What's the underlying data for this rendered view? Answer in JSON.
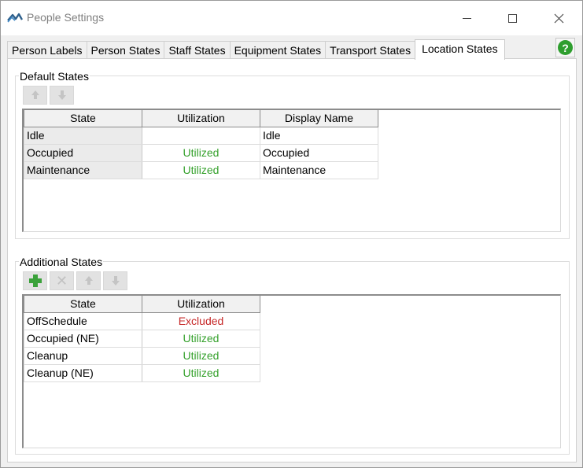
{
  "window": {
    "title": "People Settings"
  },
  "tabs": [
    {
      "label": "Person Labels"
    },
    {
      "label": "Person States"
    },
    {
      "label": "Staff States"
    },
    {
      "label": "Equipment States"
    },
    {
      "label": "Transport States"
    },
    {
      "label": "Location States",
      "active": true
    }
  ],
  "help_button": {
    "glyph": "?",
    "icon": "help-icon",
    "color": "#2e9e2e"
  },
  "default_states": {
    "group_label": "Default States",
    "columns": [
      "State",
      "Utilization",
      "Display Name"
    ],
    "rows": [
      {
        "state": "Idle",
        "utilization": "",
        "display_name": "Idle"
      },
      {
        "state": "Occupied",
        "utilization": "Utilized",
        "display_name": "Occupied"
      },
      {
        "state": "Maintenance",
        "utilization": "Utilized",
        "display_name": "Maintenance"
      }
    ],
    "toolbar": [
      "move-up-icon",
      "move-down-icon"
    ]
  },
  "additional_states": {
    "group_label": "Additional States",
    "columns": [
      "State",
      "Utilization"
    ],
    "rows": [
      {
        "state": "OffSchedule",
        "utilization": "Excluded"
      },
      {
        "state": "Occupied (NE)",
        "utilization": "Utilized"
      },
      {
        "state": "Cleanup",
        "utilization": "Utilized"
      },
      {
        "state": "Cleanup (NE)",
        "utilization": "Utilized"
      }
    ],
    "toolbar": [
      "add-icon",
      "delete-icon",
      "move-up-icon",
      "move-down-icon"
    ]
  },
  "colors": {
    "utilized": "#35a12c",
    "excluded": "#c62828",
    "add_icon": "#3aa13a"
  }
}
